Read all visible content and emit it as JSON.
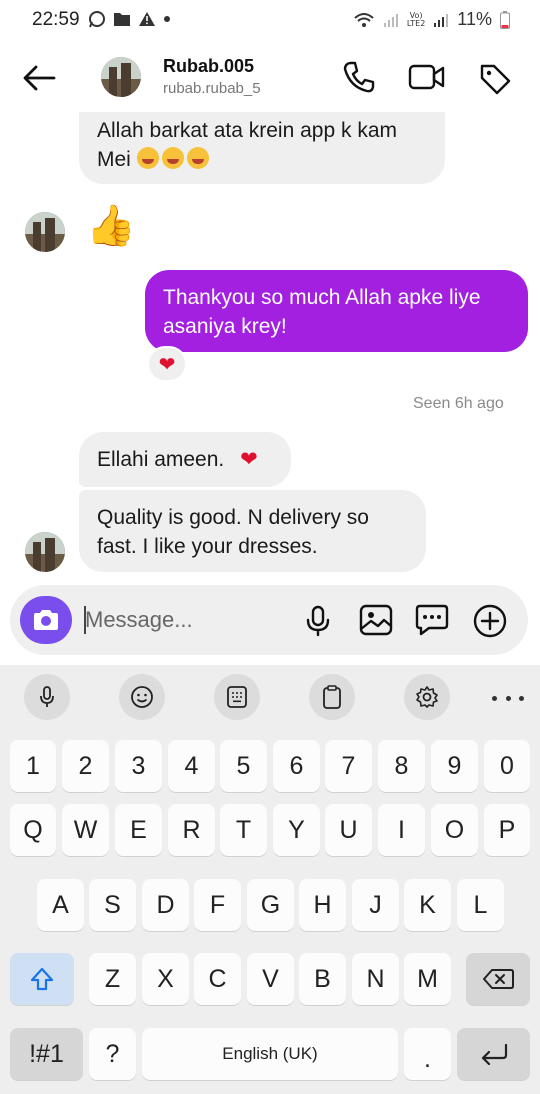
{
  "status_bar": {
    "time": "22:59",
    "battery": "11%",
    "network": "LTE2"
  },
  "header": {
    "name": "Rubab.005",
    "handle": "rubab.rubab_5"
  },
  "messages": {
    "m1_line1": "Allah barkat ata krein app k kam",
    "m1_line2": "Mei",
    "m2": "👍",
    "m3_line1": "Thankyou so much Allah apke liye",
    "m3_line2": "asaniya krey!",
    "reaction": "❤",
    "seen": "Seen 6h ago",
    "m4": "Ellahi ameen.",
    "m4_emoji": "❤",
    "m5_line1": "Quality is good.  N delivery so",
    "m5_line2": "fast.  I like your dresses."
  },
  "composer": {
    "placeholder": "Message..."
  },
  "keyboard": {
    "numbers": [
      "1",
      "2",
      "3",
      "4",
      "5",
      "6",
      "7",
      "8",
      "9",
      "0"
    ],
    "row1": [
      "Q",
      "W",
      "E",
      "R",
      "T",
      "Y",
      "U",
      "I",
      "O",
      "P"
    ],
    "row2": [
      "A",
      "S",
      "D",
      "F",
      "G",
      "H",
      "J",
      "K",
      "L"
    ],
    "row3": [
      "Z",
      "X",
      "C",
      "V",
      "B",
      "N",
      "M"
    ],
    "symbols": "!#1",
    "question": "?",
    "space": "English (UK)",
    "period": "."
  },
  "colors": {
    "sent_bubble": "#a320e0",
    "received_bubble": "#efefef",
    "camera_button": "#7a4ded",
    "heart": "#e0102f"
  }
}
